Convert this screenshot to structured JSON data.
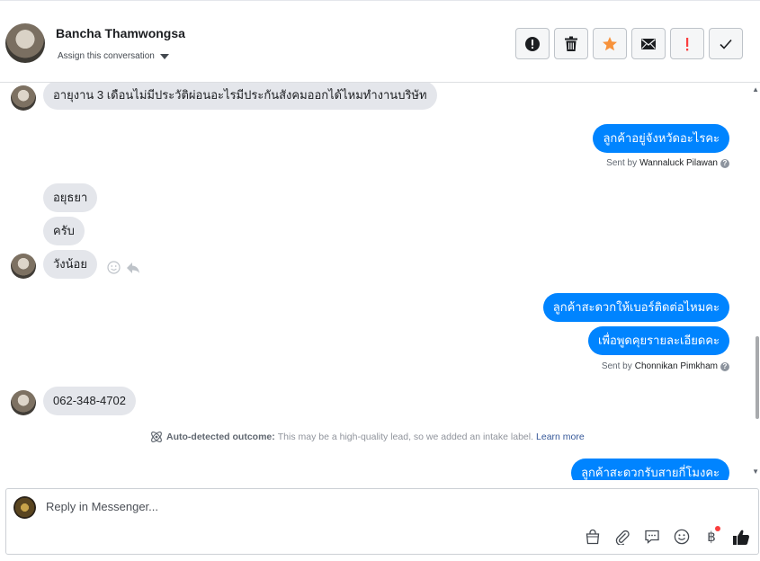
{
  "header": {
    "contact_name": "Bancha Thamwongsa",
    "assign_label": "Assign this conversation",
    "toolbar": [
      {
        "name": "mark-spam-button",
        "icon": "alert-circle-icon"
      },
      {
        "name": "delete-button",
        "icon": "trash-icon"
      },
      {
        "name": "star-button",
        "icon": "star-icon"
      },
      {
        "name": "mark-unread-button",
        "icon": "envelope-icon"
      },
      {
        "name": "follow-up-button",
        "icon": "exclamation-icon"
      },
      {
        "name": "mark-done-button",
        "icon": "checkmark-icon"
      }
    ]
  },
  "messages": {
    "m1": "อายุงาน 3 เดือนไม่มีประวัติผ่อนอะไรมีประกันสังคมออกได้ไหมทำงานบริษัท",
    "m2": "ลูกค้าอยู่จังหวัดอะไรคะ",
    "m2_sent_prefix": "Sent by",
    "m2_sender": "Wannaluck Pilawan",
    "m3": "อยุธยา",
    "m4": "ครับ",
    "m5": "วังน้อย",
    "m6": "ลูกค้าสะดวกให้เบอร์ติดต่อไหมคะ",
    "m7": "เพื่อพูดคุยรายละเอียดคะ",
    "m7_sent_prefix": "Sent by",
    "m7_sender": "Chonnikan Pimkham",
    "m8": "062-348-4702",
    "m9": "ลูกค้าสะดวกรับสายกี่โมงคะ"
  },
  "auto_detected": {
    "label": "Auto-detected outcome:",
    "text": "This may be a high-quality lead, so we added an intake label.",
    "link": "Learn more"
  },
  "composer": {
    "placeholder": "Reply in Messenger...",
    "tools": [
      "shopping-bag-icon",
      "paperclip-icon",
      "saved-reply-icon",
      "emoji-icon",
      "baht-payment-icon",
      "thumbs-up-icon"
    ]
  },
  "colors": {
    "outgoing_bubble": "#0084ff",
    "incoming_bubble": "#e4e6eb",
    "star": "#f7923b",
    "alert": "#fa3e3e"
  }
}
